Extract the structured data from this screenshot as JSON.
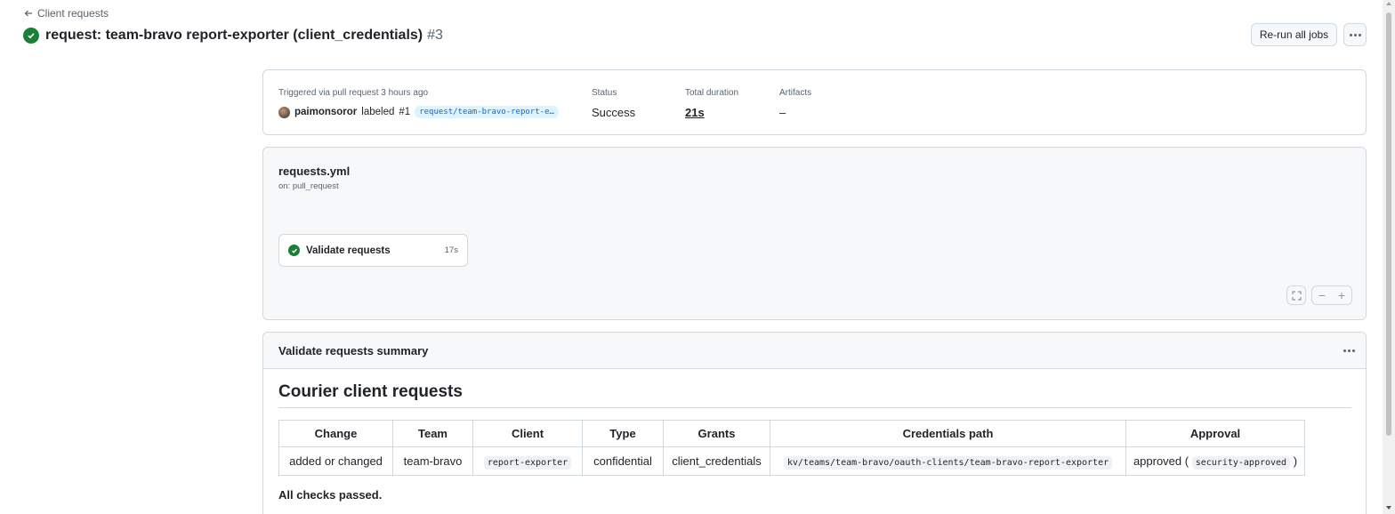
{
  "nav": {
    "back_label": "Client requests"
  },
  "run": {
    "title": "request: team-bravo report-exporter (client_credentials)",
    "number": "#3",
    "status_color": "#1a7f37"
  },
  "toolbar": {
    "rerun_label": "Re-run all jobs",
    "more_icon": "kebab-horizontal-icon"
  },
  "summary": {
    "trigger_label": "Triggered via pull request 3 hours ago",
    "user": "paimonsoror",
    "action": "labeled",
    "pr_number": "#1",
    "branch": "request/team-bravo-report-e…",
    "status_label": "Status",
    "status_value": "Success",
    "duration_label": "Total duration",
    "duration_value": "21s",
    "artifacts_label": "Artifacts",
    "artifacts_value": "–"
  },
  "workflow": {
    "file": "requests.yml",
    "trigger": "on: pull_request",
    "job": {
      "name": "Validate requests",
      "duration": "17s"
    }
  },
  "job_summary": {
    "header": "Validate requests summary",
    "heading": "Courier client requests",
    "columns": [
      "Change",
      "Team",
      "Client",
      "Type",
      "Grants",
      "Credentials path",
      "Approval"
    ],
    "row": {
      "change": "added or changed",
      "team": "team-bravo",
      "client": "report-exporter",
      "type": "confidential",
      "grants": "client_credentials",
      "path": "kv/teams/team-bravo/oauth-clients/team-bravo-report-exporter",
      "approval_prefix": "approved (",
      "approval_code": "security-approved",
      "approval_suffix": ")"
    },
    "footer": "All checks passed."
  }
}
